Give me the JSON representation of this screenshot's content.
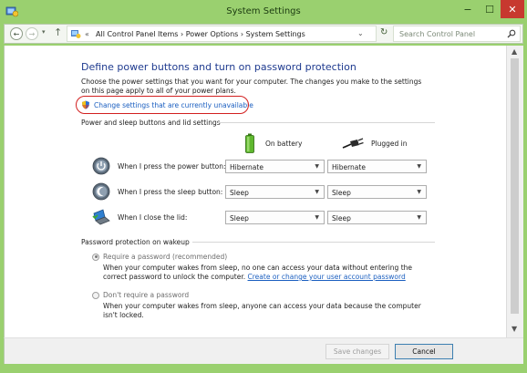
{
  "window": {
    "title": "System Settings",
    "controls": {
      "minimize": "−",
      "maximize": "☐",
      "close": "✕"
    },
    "frame_color": "#9ad06f"
  },
  "address_bar": {
    "prefix": "«",
    "breadcrumb": [
      "All Control Panel Items",
      "Power Options",
      "System Settings"
    ],
    "breadcrumb_text": "All Control Panel Items  ›  Power Options  ›  System Settings",
    "search_placeholder": "Search Control Panel"
  },
  "page": {
    "heading": "Define power buttons and turn on password protection",
    "intro": "Choose the power settings that you want for your computer. The changes you make to the settings on this page apply to all of your power plans.",
    "change_link": "Change settings that are currently unavailable"
  },
  "power_section": {
    "title": "Power and sleep buttons and lid settings",
    "columns": {
      "battery": "On battery",
      "plugged": "Plugged in"
    },
    "rows": [
      {
        "label": "When I press the power button:",
        "battery": "Hibernate",
        "plugged": "Hibernate",
        "icon": "power-button-icon"
      },
      {
        "label": "When I press the sleep button:",
        "battery": "Sleep",
        "plugged": "Sleep",
        "icon": "sleep-button-icon"
      },
      {
        "label": "When I close the lid:",
        "battery": "Sleep",
        "plugged": "Sleep",
        "icon": "laptop-lid-icon"
      }
    ]
  },
  "password_section": {
    "title": "Password protection on wakeup",
    "require": {
      "label": "Require a password (recommended)",
      "description": "When your computer wakes from sleep, no one can access your data without entering the correct password to unlock the computer.",
      "link": "Create or change your user account password",
      "checked": true
    },
    "no_require": {
      "label": "Don't require a password",
      "description": "When your computer wakes from sleep, anyone can access your data because the computer isn't locked.",
      "checked": false
    }
  },
  "footer": {
    "save_label": "Save changes",
    "cancel_label": "Cancel"
  },
  "colors": {
    "heading": "#1e3a8f",
    "link": "#1b5fc0",
    "highlight": "#d21f1f"
  }
}
